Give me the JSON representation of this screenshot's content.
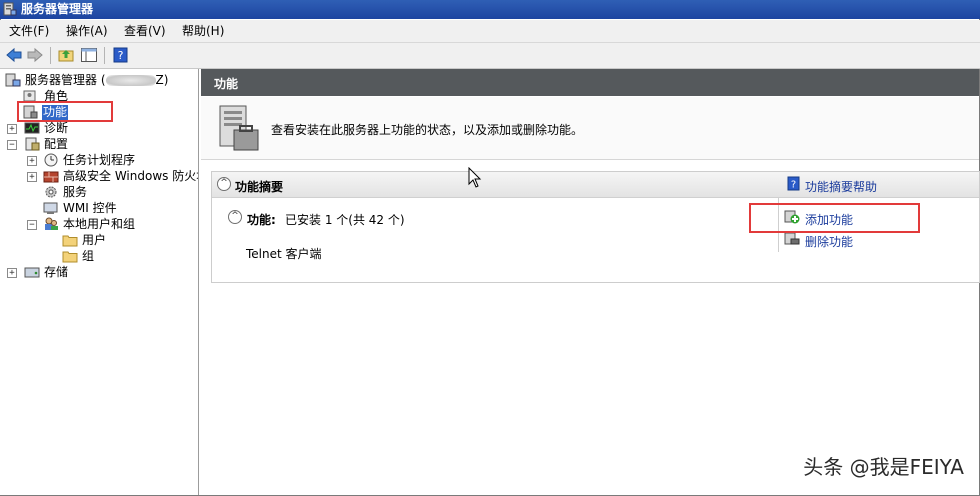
{
  "window": {
    "title": "服务器管理器"
  },
  "menu": [
    "文件(F)",
    "操作(A)",
    "查看(V)",
    "帮助(H)"
  ],
  "tree": {
    "root_label": "服务器管理器 (",
    "root_suffix": "Z)",
    "items": {
      "roles": "角色",
      "features": "功能",
      "diagnostics": "诊断",
      "configuration": "配置",
      "task_scheduler": "任务计划程序",
      "firewall": "高级安全 Windows 防火墙",
      "services": "服务",
      "wmi": "WMI 控件",
      "local_users": "本地用户和组",
      "users": "用户",
      "groups": "组",
      "storage": "存储"
    }
  },
  "pane": {
    "title": "功能",
    "description": "查看安装在此服务器上功能的状态，以及添加或删除功能。",
    "summary_title": "功能摘要",
    "help_link": "功能摘要帮助",
    "features_label": "功能:",
    "features_status": "已安装 1 个(共 42 个)",
    "installed_item": "Telnet 客户端",
    "add_feature": "添加功能",
    "remove_feature": "删除功能"
  },
  "counts": {
    "installed": 1,
    "total": 42
  },
  "watermark": "头条 @我是FEIYA",
  "colors": {
    "titlebar": "#1d44a0",
    "header": "#55595c",
    "link": "#1a3b9c",
    "highlight": "#e23a3a",
    "selection": "#3168c8"
  }
}
